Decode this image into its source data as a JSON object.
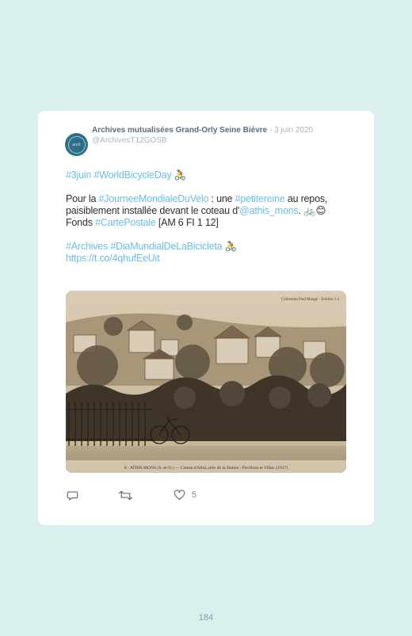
{
  "tweet": {
    "author_name": "Archives mutualisées Grand-Orly Seine Bièvre",
    "date": " - 3 juin 2020",
    "handle": "@ArchivesT12GOSB",
    "line1_tags": [
      "#3juin",
      "#WorldBicycleDay"
    ],
    "para2": {
      "t1": "Pour la ",
      "tag1": "#JourneeMondialeDuVelo",
      "t2": " : une ",
      "tag2": "#petitereine",
      "t3": " au repos, paisiblement installée devant le coteau d'",
      "mention": "@athis_mons",
      "t4": ". 🚲😊"
    },
    "para3": {
      "t1": "Fonds ",
      "tag": "#CartePostale",
      "t2": " [AM 6 FI 1 12]"
    },
    "para4_tags": [
      "#Archives",
      "#DiaMundialDeLaBicicleta"
    ],
    "link": "https://t.co/4qhufEeUit",
    "photo": {
      "caption": "8 - ATHIS-MONS (S.-et-O.) — Coteau d'Athis, près de la Station - Pavillons et Villas. (1917)",
      "corner_text": "Collection Paul Mange - Etiolles 1.4"
    },
    "like_count": "5"
  },
  "icons": {
    "reply": "reply-icon",
    "retweet": "retweet-icon",
    "like": "heart-icon",
    "bike_emoji": "🚴"
  },
  "page_number": "184",
  "colors": {
    "background": "#daf0ef",
    "link": "#6bbde6",
    "card": "#ffffff"
  }
}
